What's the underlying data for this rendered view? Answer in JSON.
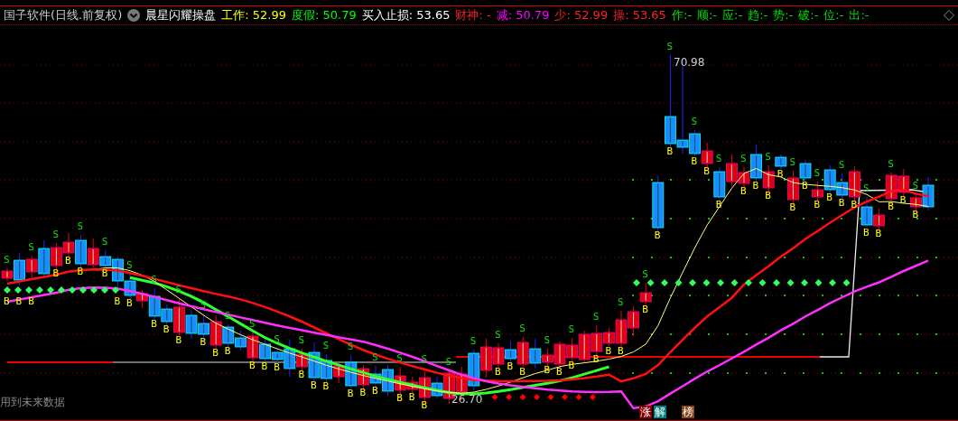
{
  "header": {
    "title": "国子软件(日线.前复权)",
    "indicator_name": "晨星闪耀操盘",
    "readings": [
      {
        "text": "工作: 52.99",
        "kind": "yellow"
      },
      {
        "text": "度假: 50.79",
        "kind": "green"
      },
      {
        "text": "买入止损: 53.65",
        "kind": "white"
      },
      {
        "text": "财神: -",
        "kind": "red"
      },
      {
        "text": "减: 50.79",
        "kind": "magenta"
      },
      {
        "text": "少: 52.99",
        "kind": "red"
      },
      {
        "text": "操: 53.65",
        "kind": "red"
      },
      {
        "text": "作:-",
        "kind": "signal"
      },
      {
        "text": "顺:-",
        "kind": "signal"
      },
      {
        "text": "应:-",
        "kind": "signal"
      },
      {
        "text": "趋:-",
        "kind": "signal"
      },
      {
        "text": "势:-",
        "kind": "signal"
      },
      {
        "text": "破:-",
        "kind": "signal"
      },
      {
        "text": "位:-",
        "kind": "signal"
      },
      {
        "text": "出:-",
        "kind": "signal"
      }
    ]
  },
  "chart": {
    "high_label": "70.98",
    "low_label": "26.70",
    "sell_marks": [
      "S",
      "S",
      "S",
      "S",
      "S",
      "S",
      "S",
      "S",
      "S",
      "S",
      "S",
      "S",
      "S",
      "S",
      "S",
      "S",
      "S",
      "S",
      "S",
      "S",
      "S",
      "S",
      "S",
      "S",
      "S",
      "S",
      "S",
      "S",
      "S",
      "S",
      "S",
      "S",
      "S",
      "S",
      "S",
      "S",
      "S",
      "S"
    ],
    "buy_marks": [
      "B",
      "B",
      "B",
      "B",
      "B",
      "B",
      "B",
      "B",
      "B",
      "B",
      "B",
      "B",
      "B",
      "B",
      "B",
      "B",
      "B",
      "B",
      "B",
      "B",
      "B",
      "B",
      "B",
      "B",
      "B",
      "B",
      "B",
      "B",
      "B",
      "B",
      "B",
      "B",
      "B",
      "B",
      "B",
      "B",
      "B",
      "B",
      "B",
      "B",
      "B",
      "B",
      "B",
      "B",
      "B",
      "B",
      "B",
      "B",
      "B",
      "B",
      "B",
      "B",
      "B",
      "B",
      "B",
      "B",
      "B"
    ]
  },
  "footer": {
    "note": "用到未来数据",
    "badges": [
      {
        "text": "涨",
        "color": "#8b0000"
      },
      {
        "text": "解",
        "color": "#008080"
      },
      {
        "text": "榜",
        "color": "#8b4513"
      }
    ]
  }
}
